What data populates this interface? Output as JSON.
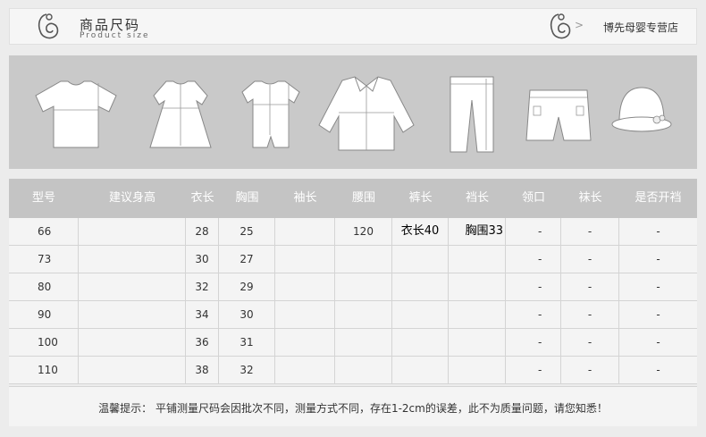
{
  "header": {
    "title_cn": "商品尺码",
    "title_en": "Product size",
    "shop_name": "博先母婴专营店",
    "arrow": ">"
  },
  "garments": [
    "tshirt-icon",
    "dress-icon",
    "romper-icon",
    "jacket-icon",
    "pants-icon",
    "shorts-icon",
    "hat-icon"
  ],
  "table": {
    "headers": [
      "型号",
      "建议身高",
      "衣长",
      "胸围",
      "袖长",
      "腰围",
      "裤长",
      "裆长",
      "领口",
      "袜长",
      "是否开裆"
    ],
    "rows": [
      [
        "66",
        "",
        "28",
        "25",
        "",
        "120",
        "衣长40",
        "胸围33",
        "-",
        "-",
        "-"
      ],
      [
        "73",
        "",
        "30",
        "27",
        "",
        "",
        "",
        "",
        "-",
        "-",
        "-"
      ],
      [
        "80",
        "",
        "32",
        "29",
        "",
        "",
        "",
        "",
        "-",
        "-",
        "-"
      ],
      [
        "90",
        "",
        "34",
        "30",
        "",
        "",
        "",
        "",
        "-",
        "-",
        "-"
      ],
      [
        "100",
        "",
        "36",
        "31",
        "",
        "",
        "",
        "",
        "-",
        "-",
        "-"
      ],
      [
        "110",
        "",
        "38",
        "32",
        "",
        "",
        "",
        "",
        "-",
        "-",
        "-"
      ]
    ]
  },
  "note": "温馨提示：  平铺测量尺码会因批次不同，测量方式不同，存在1-2cm的误差，此不为质量问题，请您知悉！",
  "colors": {
    "header_bg": "#c4c4c4",
    "banner_bg": "#c9c9c9",
    "page_bg": "#ececec"
  }
}
